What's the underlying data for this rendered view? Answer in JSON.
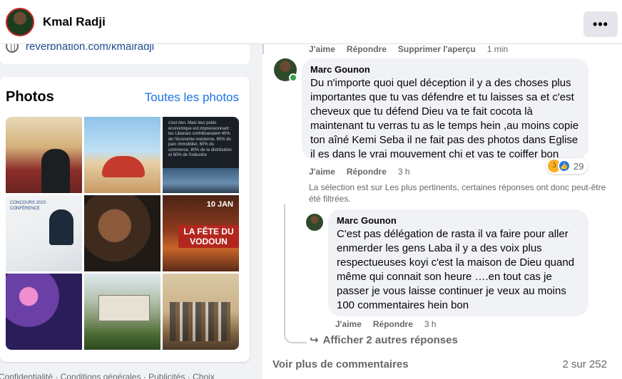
{
  "header": {
    "name": "Kmal Radji",
    "more_label": "•••"
  },
  "left": {
    "link": "reverbnation.com/kmalradji",
    "photos_title": "Photos",
    "photos_link": "Toutes les photos",
    "photo3_text": "c'est rien. Mais leur poids économique est impressionnant : les Libanais contribueraient 40% de l'économie ivoirienne, 60% du parc immobilier, 60% du commerce, 80% de la distribution et 60% de l'industrie",
    "photo4_text": "CONCOURS 2023 · CONFÉRENCE",
    "photo6_date": "10 JAN",
    "photo6_title": "LA FÊTE DU VODOUN",
    "footer": "Confidentialité · Conditions générales · Publicités · Choix"
  },
  "comments": {
    "top_actions": {
      "like": "J'aime",
      "reply": "Répondre",
      "remove_preview": "Supprimer l'aperçu",
      "time": "1 min"
    },
    "comment1": {
      "author": "Marc Gounon",
      "text": "Du n'importe quoi quel déception il y a des choses plus importantes que tu vas défendre et tu laisses sa et c'est cheveux que tu défend Dieu va te fait cocota là maintenant tu verras tu as le temps hein ,au moins copie ton aîné Kemi Seba il ne fait pas des photos dans Eglise il es dans le vrai mouvement chi et vas te coiffer bon",
      "like": "J'aime",
      "reply": "Répondre",
      "time": "3 h",
      "reaction_count": "29"
    },
    "notice": "La sélection est sur Les plus pertinents, certaines réponses ont donc peut-être été filtrées.",
    "reply1": {
      "author": "Marc Gounon",
      "text": "C'est pas délégation de rasta il va faire pour aller enmerder les gens Laba il y a des voix plus respectueuses koyi c'est la maison de Dieu quand même qui connait son heure ….en tout cas je passer je vous laisse continuer je veux au moins 100 commentaires hein bon",
      "like": "J'aime",
      "reply": "Répondre",
      "time": "3 h"
    },
    "more_replies": "Afficher 2 autres réponses",
    "view_more": "Voir plus de commentaires",
    "pager": "2 sur 252"
  }
}
